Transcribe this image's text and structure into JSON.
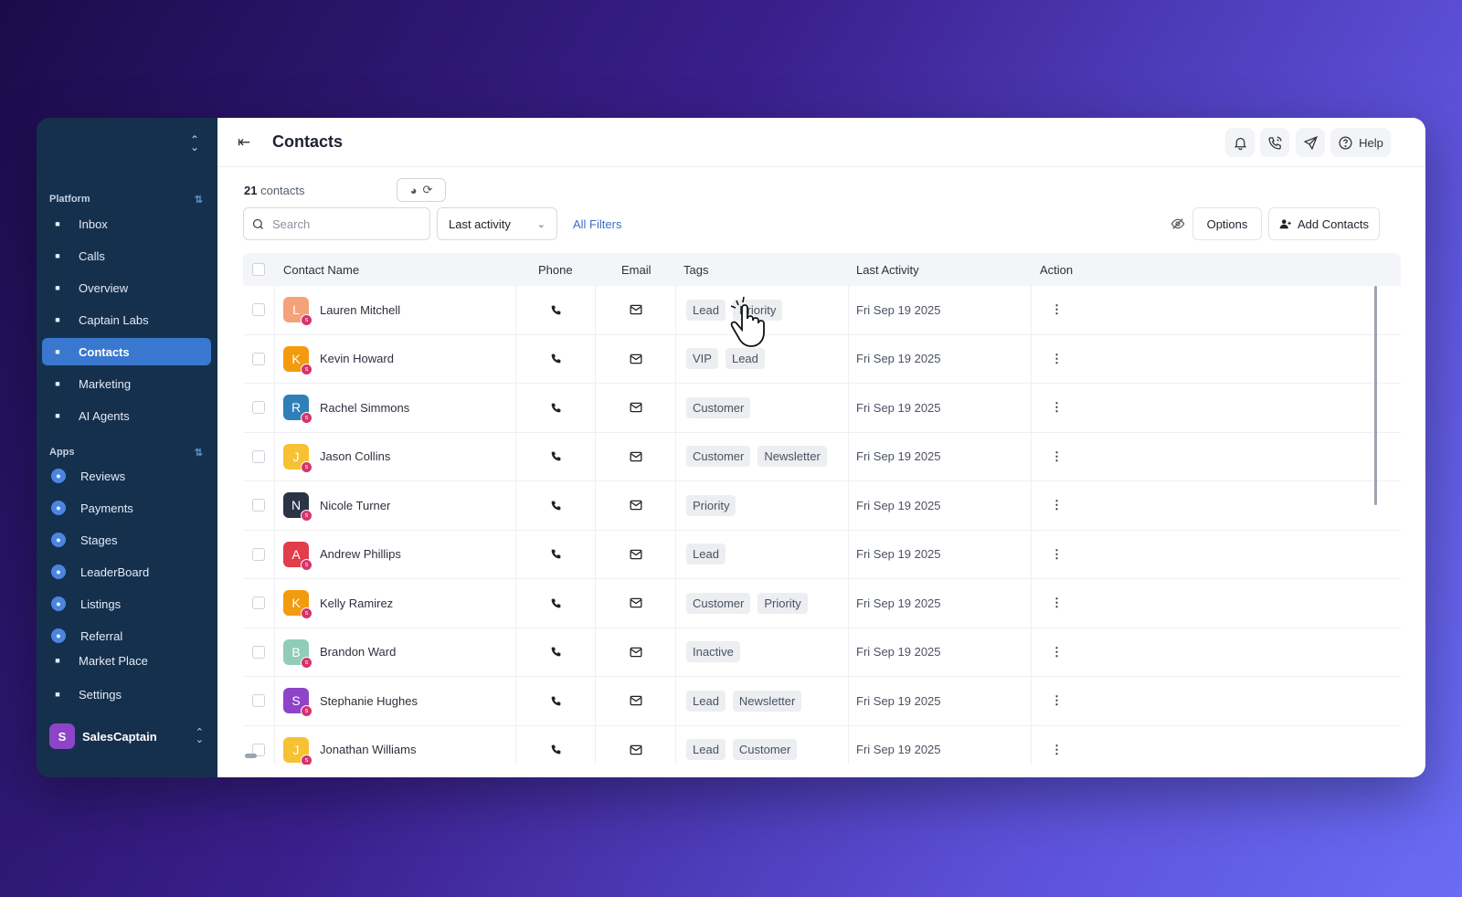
{
  "sidebar": {
    "sections": [
      {
        "label": "Platform"
      },
      {
        "label": "Apps"
      }
    ],
    "platform_items": [
      {
        "label": "Inbox",
        "icon": "chat-icon"
      },
      {
        "label": "Calls",
        "icon": "phone-icon"
      },
      {
        "label": "Overview",
        "icon": "home-icon"
      },
      {
        "label": "Captain Labs",
        "icon": "flask-icon"
      },
      {
        "label": "Contacts",
        "icon": "users-icon"
      },
      {
        "label": "Marketing",
        "icon": "megaphone-icon"
      },
      {
        "label": "AI Agents",
        "icon": "bot-icon"
      }
    ],
    "app_items": [
      {
        "label": "Reviews",
        "icon": "star-icon"
      },
      {
        "label": "Payments",
        "icon": "dollar-icon"
      },
      {
        "label": "Stages",
        "icon": "funnel-icon"
      },
      {
        "label": "LeaderBoard",
        "icon": "trophy-icon"
      },
      {
        "label": "Listings",
        "icon": "pin-icon"
      },
      {
        "label": "Referral",
        "icon": "share-icon"
      }
    ],
    "bottom_items": [
      {
        "label": "Market Place",
        "icon": "bag-icon"
      },
      {
        "label": "Settings",
        "icon": "user-gear-icon"
      }
    ],
    "workspace": {
      "initial": "S",
      "name": "SalesCaptain"
    }
  },
  "header": {
    "title": "Contacts",
    "help_label": "Help"
  },
  "toolbar": {
    "count": "21",
    "count_suffix": "contacts",
    "search_placeholder": "Search",
    "sort_value": "Last activity",
    "all_filters": "All Filters",
    "options_label": "Options",
    "add_contacts_label": "Add Contacts"
  },
  "table": {
    "columns": [
      "Contact Name",
      "Phone",
      "Email",
      "Tags",
      "Last Activity",
      "Action"
    ],
    "rows": [
      {
        "initial": "L",
        "name": "Lauren Mitchell",
        "color": "#f4a27a",
        "tags": [
          "Lead",
          "Priority"
        ],
        "last_activity": "Fri Sep 19 2025"
      },
      {
        "initial": "K",
        "name": "Kevin Howard",
        "color": "#f29b0f",
        "tags": [
          "VIP",
          "Lead"
        ],
        "last_activity": "Fri Sep 19 2025"
      },
      {
        "initial": "R",
        "name": "Rachel Simmons",
        "color": "#2f7fb8",
        "tags": [
          "Customer"
        ],
        "last_activity": "Fri Sep 19 2025"
      },
      {
        "initial": "J",
        "name": "Jason Collins",
        "color": "#f6c233",
        "tags": [
          "Customer",
          "Newsletter"
        ],
        "last_activity": "Fri Sep 19 2025"
      },
      {
        "initial": "N",
        "name": "Nicole Turner",
        "color": "#2a3446",
        "tags": [
          "Priority"
        ],
        "last_activity": "Fri Sep 19 2025"
      },
      {
        "initial": "A",
        "name": "Andrew Phillips",
        "color": "#e23d4b",
        "tags": [
          "Lead"
        ],
        "last_activity": "Fri Sep 19 2025"
      },
      {
        "initial": "K",
        "name": "Kelly Ramirez",
        "color": "#f29b0f",
        "tags": [
          "Customer",
          "Priority"
        ],
        "last_activity": "Fri Sep 19 2025"
      },
      {
        "initial": "B",
        "name": "Brandon Ward",
        "color": "#8fcdb8",
        "tags": [
          "Inactive"
        ],
        "last_activity": "Fri Sep 19 2025"
      },
      {
        "initial": "S",
        "name": "Stephanie Hughes",
        "color": "#8e44c9",
        "tags": [
          "Lead",
          "Newsletter"
        ],
        "last_activity": "Fri Sep 19 2025"
      },
      {
        "initial": "J",
        "name": "Jonathan Williams",
        "color": "#f6c233",
        "tags": [
          "Lead",
          "Customer"
        ],
        "last_activity": "Fri Sep 19 2025"
      }
    ]
  },
  "colors": {
    "sidebar_bg": "#15304d",
    "active_item": "#3a78cf",
    "link": "#3d6fc4"
  }
}
